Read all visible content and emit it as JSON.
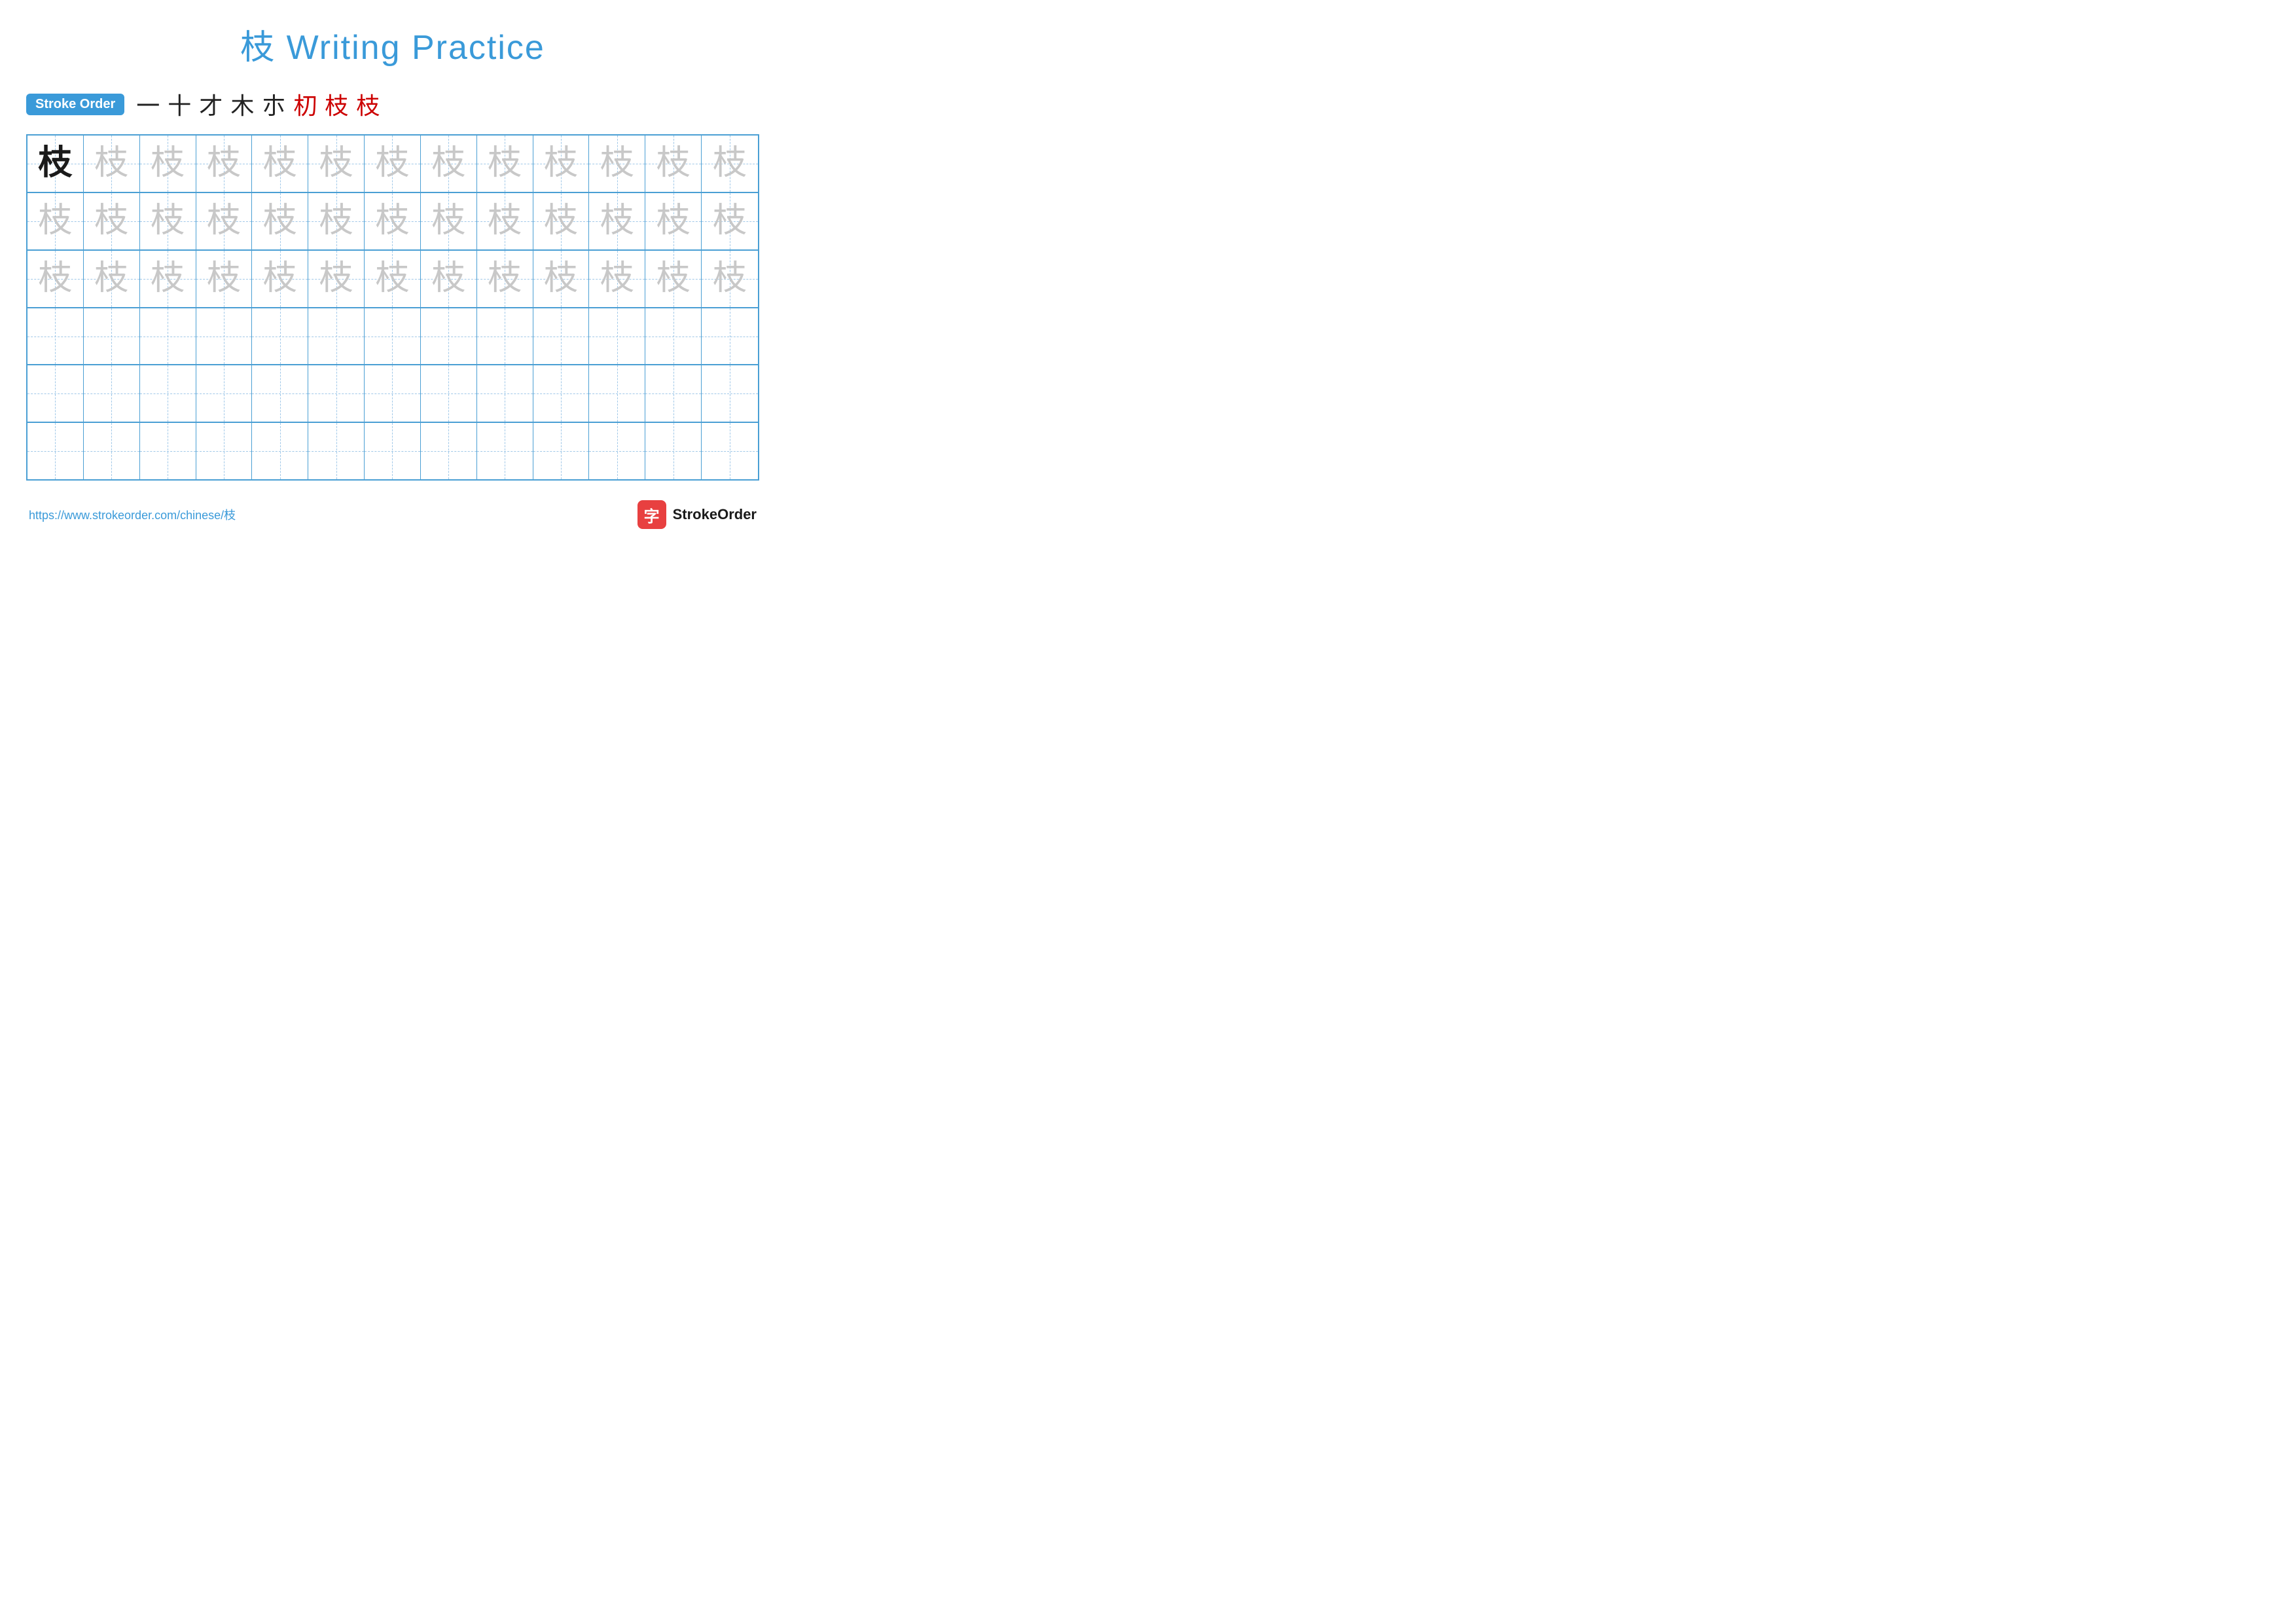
{
  "title": {
    "char": "枝",
    "text": "Writing Practice",
    "full": "枝 Writing Practice"
  },
  "stroke_order": {
    "badge_label": "Stroke Order",
    "steps": [
      {
        "char": "一",
        "color": "black"
      },
      {
        "char": "十",
        "color": "black"
      },
      {
        "char": "才",
        "color": "black"
      },
      {
        "char": "木",
        "color": "black"
      },
      {
        "char": "朩",
        "color": "black"
      },
      {
        "char": "朷",
        "color": "red"
      },
      {
        "char": "枝",
        "color": "red"
      },
      {
        "char": "枝",
        "color": "red"
      }
    ]
  },
  "grid": {
    "cols": 13,
    "rows": [
      {
        "type": "practice",
        "cells": [
          {
            "char": "枝",
            "style": "dark"
          },
          {
            "char": "枝",
            "style": "light"
          },
          {
            "char": "枝",
            "style": "light"
          },
          {
            "char": "枝",
            "style": "light"
          },
          {
            "char": "枝",
            "style": "light"
          },
          {
            "char": "枝",
            "style": "light"
          },
          {
            "char": "枝",
            "style": "light"
          },
          {
            "char": "枝",
            "style": "light"
          },
          {
            "char": "枝",
            "style": "light"
          },
          {
            "char": "枝",
            "style": "light"
          },
          {
            "char": "枝",
            "style": "light"
          },
          {
            "char": "枝",
            "style": "light"
          },
          {
            "char": "枝",
            "style": "light"
          }
        ]
      },
      {
        "type": "practice",
        "cells": [
          {
            "char": "枝",
            "style": "light"
          },
          {
            "char": "枝",
            "style": "light"
          },
          {
            "char": "枝",
            "style": "light"
          },
          {
            "char": "枝",
            "style": "light"
          },
          {
            "char": "枝",
            "style": "light"
          },
          {
            "char": "枝",
            "style": "light"
          },
          {
            "char": "枝",
            "style": "light"
          },
          {
            "char": "枝",
            "style": "light"
          },
          {
            "char": "枝",
            "style": "light"
          },
          {
            "char": "枝",
            "style": "light"
          },
          {
            "char": "枝",
            "style": "light"
          },
          {
            "char": "枝",
            "style": "light"
          },
          {
            "char": "枝",
            "style": "light"
          }
        ]
      },
      {
        "type": "practice",
        "cells": [
          {
            "char": "枝",
            "style": "light"
          },
          {
            "char": "枝",
            "style": "light"
          },
          {
            "char": "枝",
            "style": "light"
          },
          {
            "char": "枝",
            "style": "light"
          },
          {
            "char": "枝",
            "style": "light"
          },
          {
            "char": "枝",
            "style": "light"
          },
          {
            "char": "枝",
            "style": "light"
          },
          {
            "char": "枝",
            "style": "light"
          },
          {
            "char": "枝",
            "style": "light"
          },
          {
            "char": "枝",
            "style": "light"
          },
          {
            "char": "枝",
            "style": "light"
          },
          {
            "char": "枝",
            "style": "light"
          },
          {
            "char": "枝",
            "style": "light"
          }
        ]
      },
      {
        "type": "empty"
      },
      {
        "type": "empty"
      },
      {
        "type": "empty"
      }
    ]
  },
  "footer": {
    "url": "https://www.strokeorder.com/chinese/枝",
    "brand": "StrokeOrder",
    "logo_char": "字"
  }
}
